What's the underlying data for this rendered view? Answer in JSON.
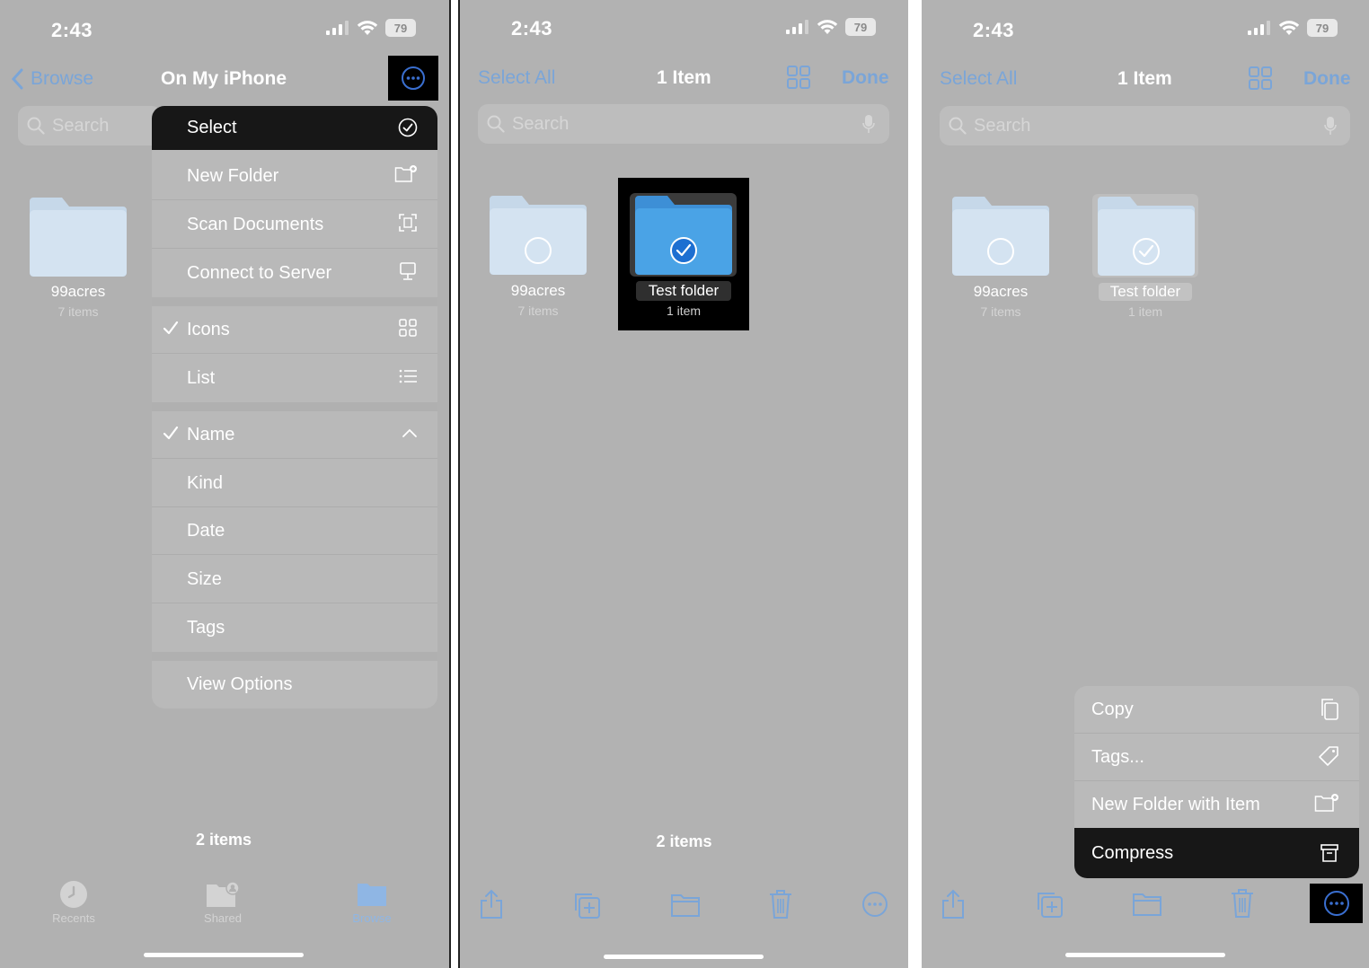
{
  "panel1": {
    "status": {
      "time": "2:43",
      "battery": "79"
    },
    "nav": {
      "back_label": "Browse",
      "title": "On My iPhone"
    },
    "search": {
      "placeholder": "Search"
    },
    "folders": [
      {
        "name": "99acres",
        "count": "7 items"
      }
    ],
    "menu": {
      "select": "Select",
      "new_folder": "New Folder",
      "scan_documents": "Scan Documents",
      "connect_to_server": "Connect to Server",
      "icons": "Icons",
      "list": "List",
      "name": "Name",
      "kind": "Kind",
      "date": "Date",
      "size": "Size",
      "tags": "Tags",
      "view_options": "View Options"
    },
    "footer": {
      "items_count": "2 items"
    },
    "tabs": {
      "recents": "Recents",
      "shared": "Shared",
      "browse": "Browse"
    }
  },
  "panel2": {
    "status": {
      "time": "2:43",
      "battery": "79"
    },
    "nav": {
      "select_all": "Select All",
      "title": "1 Item",
      "done": "Done"
    },
    "search": {
      "placeholder": "Search"
    },
    "folders": [
      {
        "name": "99acres",
        "count": "7 items"
      },
      {
        "name": "Test folder",
        "count": "1 item"
      }
    ],
    "footer": {
      "items_count": "2 items"
    }
  },
  "panel3": {
    "status": {
      "time": "2:43",
      "battery": "79"
    },
    "nav": {
      "select_all": "Select All",
      "title": "1 Item",
      "done": "Done"
    },
    "search": {
      "placeholder": "Search"
    },
    "folders": [
      {
        "name": "99acres",
        "count": "7 items"
      },
      {
        "name": "Test folder",
        "count": "1 item"
      }
    ],
    "menu": {
      "copy": "Copy",
      "tags": "Tags...",
      "new_folder_with_item": "New Folder with Item",
      "compress": "Compress"
    }
  },
  "colors": {
    "accent": "#7aa5d8",
    "folder_light": "#d4e3f1",
    "folder_selected": "#4aa3e6",
    "highlight": "#000000"
  }
}
